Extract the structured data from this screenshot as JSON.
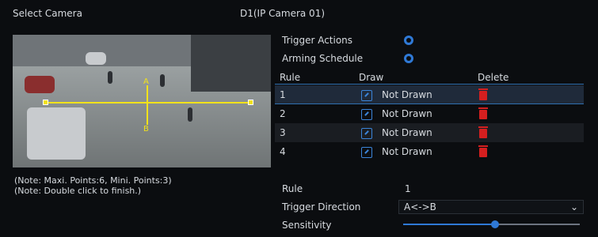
{
  "header": {
    "select_camera": "Select Camera",
    "camera_name": "D1(IP Camera 01)"
  },
  "actions": {
    "trigger_actions": "Trigger Actions",
    "arming_schedule": "Arming Schedule"
  },
  "table": {
    "headers": [
      "Rule",
      "Draw",
      "Delete"
    ],
    "rows": [
      {
        "rule": "1",
        "status": "Not Drawn"
      },
      {
        "rule": "2",
        "status": "Not Drawn"
      },
      {
        "rule": "3",
        "status": "Not Drawn"
      },
      {
        "rule": "4",
        "status": "Not Drawn"
      }
    ]
  },
  "notes": {
    "points": "(Note: Maxi. Points:6, Mini. Points:3)",
    "finish": "(Note: Double click to finish.)"
  },
  "form": {
    "rule_label": "Rule",
    "rule_value": "1",
    "trigger_direction_label": "Trigger Direction",
    "trigger_direction_value": "A<->B",
    "sensitivity_label": "Sensitivity",
    "sensitivity_value": 0.52
  },
  "preview": {
    "marker_a": "A",
    "marker_b": "B"
  },
  "colors": {
    "accent": "#2f79d6",
    "line": "#f2e21a",
    "delete": "#d51f1f"
  },
  "icons": {
    "trigger_settings": "gear-icon",
    "schedule_settings": "gear-icon",
    "draw": "edit-icon",
    "delete": "trash-icon",
    "dropdown": "chevron-down-icon"
  }
}
